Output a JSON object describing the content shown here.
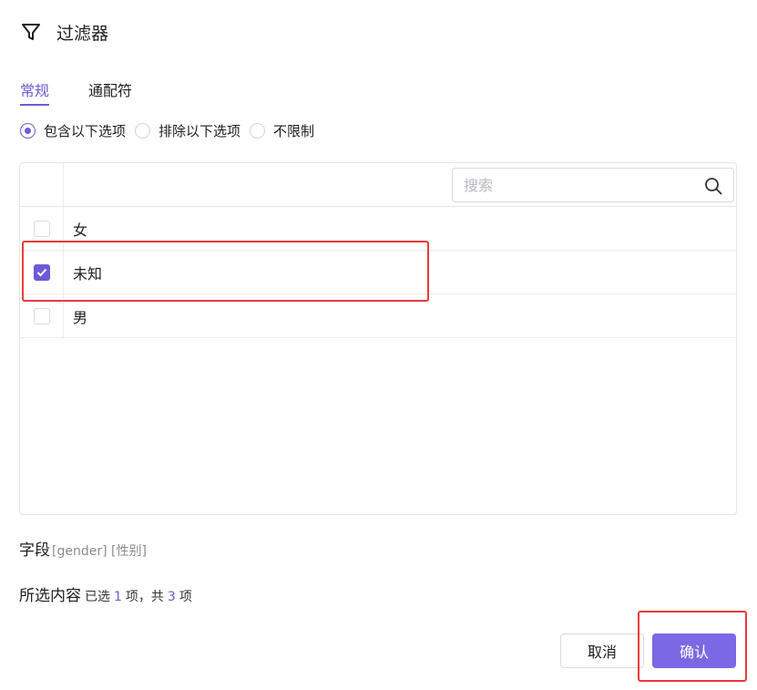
{
  "header": {
    "title": "过滤器",
    "icon": "filter-icon"
  },
  "tabs": [
    {
      "label": "常规",
      "active": true
    },
    {
      "label": "通配符",
      "active": false
    }
  ],
  "radio_options": [
    {
      "label": "包含以下选项",
      "checked": true
    },
    {
      "label": "排除以下选项",
      "checked": false
    },
    {
      "label": "不限制",
      "checked": false
    }
  ],
  "search": {
    "placeholder": "搜索",
    "value": ""
  },
  "items": [
    {
      "label": "女",
      "checked": false
    },
    {
      "label": "未知",
      "checked": true
    },
    {
      "label": "男",
      "checked": false
    }
  ],
  "field": {
    "label": "字段",
    "detail": "[gender] [性别]"
  },
  "selection": {
    "label": "所选内容",
    "prefix": "已选",
    "selected_count": "1",
    "middle": "项，共",
    "total_count": "3",
    "suffix": "项"
  },
  "buttons": {
    "cancel": "取消",
    "confirm": "确认"
  },
  "colors": {
    "accent": "#6b5bd6",
    "confirm_bg": "#7b68e4",
    "highlight": "#e83b3b"
  }
}
